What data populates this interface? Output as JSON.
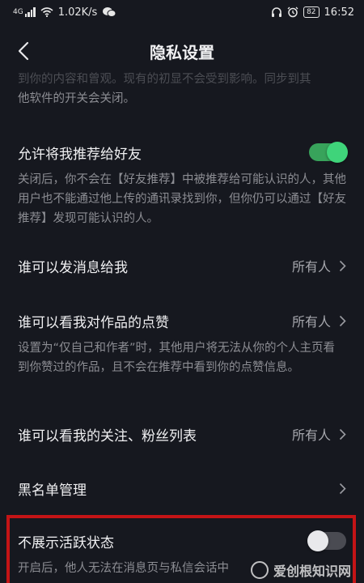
{
  "status_bar": {
    "network": "4G",
    "speed": "1.02K/s",
    "battery": "82",
    "time": "16:52"
  },
  "header": {
    "title": "隐私设置"
  },
  "faded_top": {
    "line1": "到你的内容和曾观。现有的初显不会受到影响。同步到其",
    "line2": "他软件的开关会关闭。"
  },
  "settings": {
    "recommend": {
      "label": "允许将我推荐给好友",
      "toggle_on": true,
      "desc": "关闭后，你不会在【好友推荐】中被推荐给可能认识的人，其他用户也不能通过他上传的通讯录找到你，但你仍可以通过【好友推荐】发现可能认识的人。"
    },
    "message": {
      "label": "谁可以发消息给我",
      "value": "所有人"
    },
    "likes": {
      "label": "谁可以看我对作品的点赞",
      "value": "所有人",
      "desc": "设置为“仅自己和作者”时，其他用户将无法从你的个人主页看到你赞过的作品，且不会在推荐中看到你的点赞信息。"
    },
    "follow_list": {
      "label": "谁可以看我的关注、粉丝列表",
      "value": "所有人"
    },
    "blacklist": {
      "label": "黑名单管理"
    },
    "active_status": {
      "label": "不展示活跃状态",
      "toggle_on": false,
      "desc": "开启后，他人无法在消息页与私信会话中"
    }
  },
  "watermark": {
    "text": "爱创根知识网"
  },
  "colors": {
    "background": "#16181f",
    "toggle_on": "#3fd47a",
    "highlight_border": "#c41416"
  }
}
